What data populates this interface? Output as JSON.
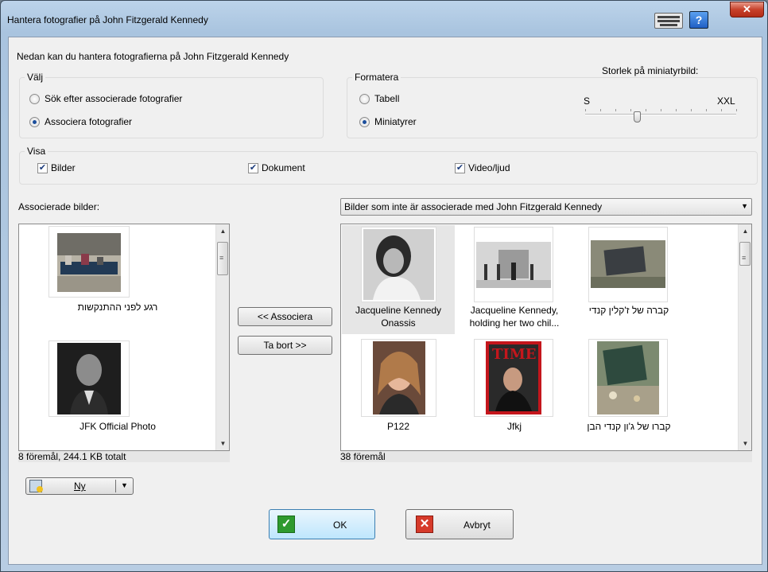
{
  "window": {
    "title": "Hantera fotografier på John Fitzgerald Kennedy"
  },
  "header": {
    "text": "Nedan kan du hantera fotografierna på John Fitzgerald Kennedy"
  },
  "choose": {
    "legend": "Välj",
    "option1": "Sök efter associerade fotografier",
    "option2": "Associera fotografier",
    "selected": 2
  },
  "format": {
    "legend": "Formatera",
    "option1": "Tabell",
    "option2": "Miniatyrer",
    "selected": 2,
    "size_label": "Storlek på miniatyrbild:",
    "size_min": "S",
    "size_max": "XXL",
    "slider_position": 0.35
  },
  "show": {
    "legend": "Visa",
    "images": "Bilder",
    "documents": "Dokument",
    "video": "Video/ljud"
  },
  "left": {
    "label": "Associerade bilder:",
    "items": [
      {
        "caption": "רגע לפני ההתנקשות"
      },
      {
        "caption": "JFK Official Photo"
      }
    ],
    "status": "8 föremål, 244.1 KB totalt"
  },
  "right": {
    "dropdown": "Bilder som inte är associerade med John Fitzgerald Kennedy",
    "items": [
      {
        "caption": "Jacqueline Kennedy Onassis"
      },
      {
        "caption": "Jacqueline Kennedy, holding her two chil..."
      },
      {
        "caption": "קברה של ז'קלין קנדי"
      },
      {
        "caption": "P122"
      },
      {
        "caption": "Jfkj"
      },
      {
        "caption": "קברו של ג'ון קנדי הבן"
      }
    ],
    "status": "38 föremål"
  },
  "actions": {
    "associate": "<< Associera",
    "remove": "Ta bort >>",
    "new": "Ny",
    "ok": "OK",
    "cancel": "Avbryt"
  },
  "colors": {
    "ok_green": "#2e9a2e",
    "cancel_red": "#d63a2a",
    "accent": "#3a7bd5"
  }
}
